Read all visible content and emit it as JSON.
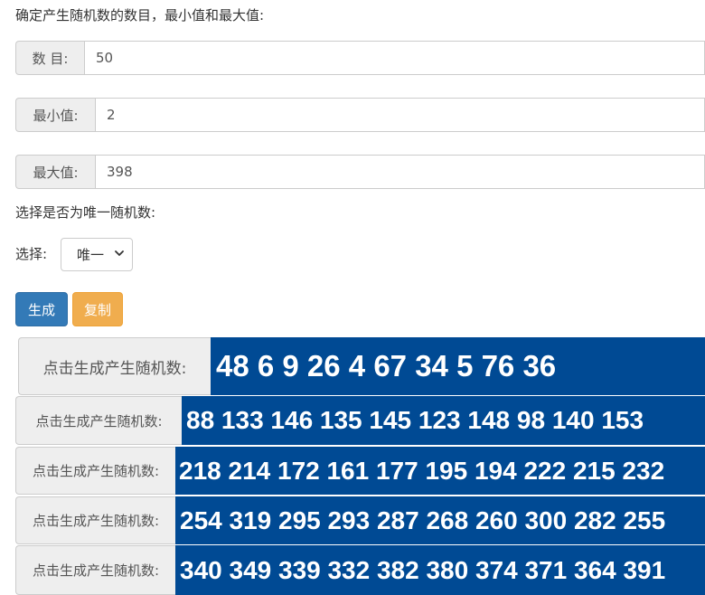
{
  "form": {
    "heading": "确定产生随机数的数目，最小值和最大值:",
    "count": {
      "label": "数 目:",
      "value": "50"
    },
    "min": {
      "label": "最小值:",
      "value": "2"
    },
    "max": {
      "label": "最大值:",
      "value": "398"
    },
    "unique_heading": "选择是否为唯一随机数:",
    "select_label": "选择:",
    "select_value": "唯一"
  },
  "buttons": {
    "generate": "生成",
    "copy": "复制"
  },
  "results": [
    {
      "label": "点击生成产生随机数:",
      "values": "48 6 9 26 4 67 34 5 76 36"
    },
    {
      "label": "点击生成产生随机数:",
      "values": "88 133 146 135 145 123 148 98 140 153"
    },
    {
      "label": "点击生成产生随机数:",
      "values": "218 214 172 161 177 195 194 222 215 232"
    },
    {
      "label": "点击生成产生随机数:",
      "values": "254 319 295 293 287 268 260 300 282 255"
    },
    {
      "label": "点击生成产生随机数:",
      "values": "340 349 339 332 382 380 374 371 364 391"
    }
  ]
}
